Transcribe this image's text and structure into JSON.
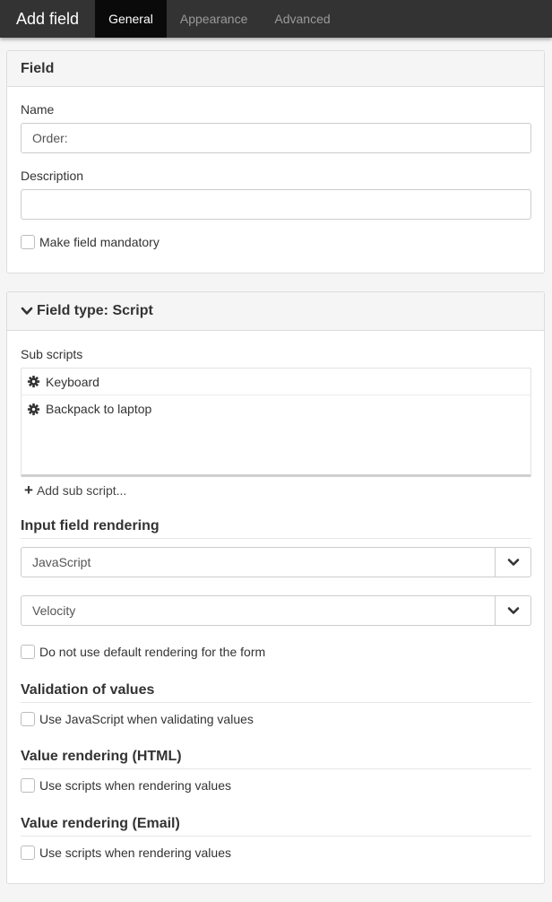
{
  "topbar": {
    "title": "Add field",
    "tabs": [
      {
        "label": "General",
        "active": true
      },
      {
        "label": "Appearance",
        "active": false
      },
      {
        "label": "Advanced",
        "active": false
      }
    ]
  },
  "field_panel": {
    "heading": "Field",
    "name_label": "Name",
    "name_value": "Order:",
    "description_label": "Description",
    "description_value": "",
    "mandatory_label": "Make field mandatory",
    "mandatory_checked": false
  },
  "type_panel": {
    "heading": "Field type: Script",
    "sub_scripts_label": "Sub scripts",
    "sub_scripts": [
      {
        "label": "Keyboard",
        "icon": "gear-icon"
      },
      {
        "label": "Backpack to laptop",
        "icon": "gear-icon"
      }
    ],
    "add_sub_script_label": "Add sub script...",
    "input_rendering_title": "Input field rendering",
    "select_1_value": "JavaScript",
    "select_2_value": "Velocity",
    "no_default_rendering_label": "Do not use default rendering for the form",
    "validation_title": "Validation of values",
    "validation_check_label": "Use JavaScript when validating values",
    "value_html_title": "Value rendering (HTML)",
    "value_html_check_label": "Use scripts when rendering values",
    "value_email_title": "Value rendering (Email)",
    "value_email_check_label": "Use scripts when rendering values"
  },
  "colors": {
    "topbar_bg": "#333333",
    "active_tab_bg": "#0a0a0a",
    "inactive_tab_text": "#9a9a9a"
  }
}
